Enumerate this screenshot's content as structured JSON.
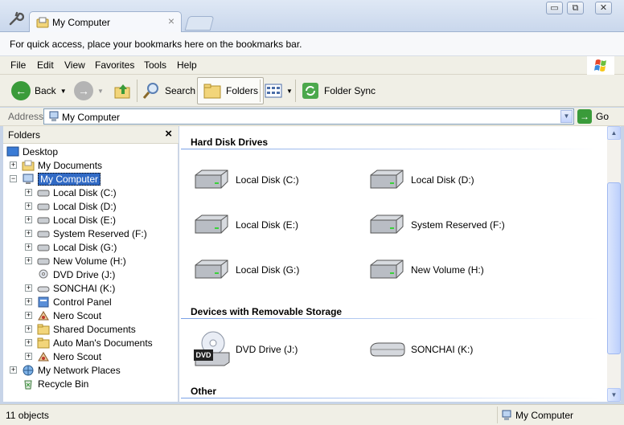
{
  "browser": {
    "tab_title": "My Computer",
    "tab_close": "×",
    "window_buttons": {
      "minimize": "▭",
      "restore": "⧉",
      "close": "✕"
    }
  },
  "bookmark_bar": {
    "text": "For quick access, place your bookmarks here on the bookmarks bar."
  },
  "menu": [
    "File",
    "Edit",
    "View",
    "Favorites",
    "Tools",
    "Help"
  ],
  "toolbar": {
    "back_label": "Back",
    "search_label": "Search",
    "folders_label": "Folders",
    "sync_label": "Folder Sync"
  },
  "address": {
    "label": "Address",
    "value": "My Computer",
    "go_label": "Go"
  },
  "folder_pane": {
    "title": "Folders",
    "close": "×",
    "tree": [
      {
        "label": "Desktop",
        "expander": ""
      },
      {
        "label": "My Documents",
        "expander": "+"
      },
      {
        "label": "My Computer",
        "expander": "−"
      },
      {
        "label": "Local Disk (C:)",
        "expander": "+"
      },
      {
        "label": "Local Disk (D:)",
        "expander": "+"
      },
      {
        "label": "Local Disk (E:)",
        "expander": "+"
      },
      {
        "label": "System Reserved (F:)",
        "expander": "+"
      },
      {
        "label": "Local Disk (G:)",
        "expander": "+"
      },
      {
        "label": "New Volume (H:)",
        "expander": "+"
      },
      {
        "label": "DVD Drive (J:)",
        "expander": ""
      },
      {
        "label": "SONCHAI (K:)",
        "expander": "+"
      },
      {
        "label": "Control Panel",
        "expander": "+"
      },
      {
        "label": "Nero Scout",
        "expander": "+"
      },
      {
        "label": "Shared Documents",
        "expander": "+"
      },
      {
        "label": "Auto Man's Documents",
        "expander": "+"
      },
      {
        "label": "Nero Scout",
        "expander": "+"
      },
      {
        "label": "My Network Places",
        "expander": "+"
      },
      {
        "label": "Recycle Bin",
        "expander": ""
      }
    ]
  },
  "content": {
    "groups": [
      {
        "title": "Hard Disk Drives"
      },
      {
        "title": "Devices with Removable Storage"
      },
      {
        "title": "Other"
      }
    ],
    "drives": [
      "Local Disk (C:)",
      "Local Disk (D:)",
      "Local Disk (E:)",
      "System Reserved (F:)",
      "Local Disk (G:)",
      "New Volume (H:)",
      "DVD Drive (J:)",
      "SONCHAI (K:)"
    ],
    "dvd_badge": "DVD"
  },
  "status": {
    "count": "11 objects",
    "location": "My Computer"
  }
}
